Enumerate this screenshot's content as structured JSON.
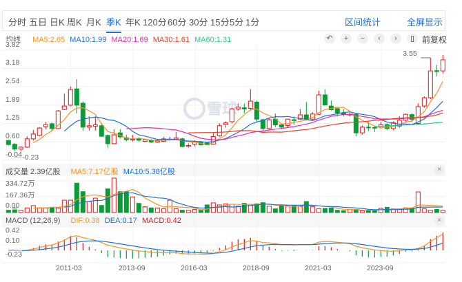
{
  "tabs": [
    "分时",
    "五日",
    "日K",
    "周K",
    "月K",
    "季K",
    "年K",
    "120分",
    "60分",
    "30分",
    "15分",
    "5分",
    "1分"
  ],
  "active_tab": "季K",
  "links": {
    "range_stats": "区间统计",
    "fullscreen": "全屏显示"
  },
  "ma_bar": {
    "label": "均线",
    "ma5": "MA5:2.65",
    "ma10": "MA10:1.99",
    "ma20": "MA20:1.69",
    "ma30": "MA30:1.61",
    "ma60": "MA60:1.31"
  },
  "tools": {
    "undo": "↶",
    "zoom_in": "+",
    "zoom_out": "−",
    "prev": "‹",
    "next": "›",
    "adjust": "前复权"
  },
  "watermark": "雪球",
  "colors": {
    "up": "#e4151b",
    "down": "#0a9b38",
    "ma5": "#f7931e",
    "ma10": "#1c6fd6",
    "ma20": "#e628b5",
    "ma30": "#f23b20",
    "ma60": "#1ccf8a"
  },
  "volume_bar": {
    "label": "成交量 2.39亿股",
    "ma5": "MA5:7.17亿股",
    "ma10": "MA10:5.38亿股",
    "close": "×"
  },
  "macd_bar": {
    "label": "MACD (12,26,9)",
    "dif": "DIF:0.38",
    "dea": "DEA:0.17",
    "macd": "MACD:0.42",
    "close": "×"
  },
  "chart_data": {
    "type": "candlestick",
    "price_ticks": [
      "3.82",
      "3.18",
      "2.54",
      "1.89",
      "1.25",
      "0.60",
      "-0.04"
    ],
    "price_range": [
      -0.04,
      3.82
    ],
    "max_label": "3.55",
    "min_label": "-0.23",
    "volume_ticks": [
      "334.72万",
      "167.36万",
      "0.00"
    ],
    "volume_max": 334.72,
    "macd_ticks": [
      "0.42",
      "0.10",
      "-0.23"
    ],
    "x_labels": [
      "2011-03",
      "2013-09",
      "2016-03",
      "2018-09",
      "2021-03",
      "2023-09"
    ],
    "candles": [
      [
        0.66,
        0.51,
        0.72,
        0.48
      ],
      [
        0.52,
        0.35,
        0.56,
        0.14
      ],
      [
        0.35,
        0.42,
        0.45,
        0.25
      ],
      [
        0.42,
        0.71,
        0.8,
        0.4
      ],
      [
        0.71,
        0.88,
        1.02,
        0.65
      ],
      [
        0.83,
        1.09,
        1.12,
        0.8
      ],
      [
        1.14,
        1.21,
        1.3,
        1.05
      ],
      [
        1.24,
        1.07,
        1.28,
        1.0
      ],
      [
        1.07,
        1.69,
        1.72,
        1.05
      ],
      [
        1.74,
        1.86,
        2.3,
        1.72
      ],
      [
        1.89,
        2.44,
        2.54,
        1.85
      ],
      [
        2.46,
        1.89,
        2.8,
        1.6
      ],
      [
        1.96,
        1.12,
        2.02,
        1.0
      ],
      [
        1.12,
        1.17,
        1.5,
        1.0
      ],
      [
        1.15,
        1.2,
        1.5,
        1.0
      ],
      [
        1.17,
        0.8,
        1.25,
        0.78
      ],
      [
        0.83,
        0.54,
        0.86,
        0.4
      ],
      [
        0.54,
        0.85,
        1.05,
        0.52
      ],
      [
        0.92,
        0.78,
        1.05,
        0.72
      ],
      [
        0.75,
        0.68,
        0.85,
        0.62
      ],
      [
        0.68,
        0.7,
        0.85,
        0.62
      ],
      [
        0.71,
        0.66,
        0.76,
        0.62
      ],
      [
        0.62,
        0.68,
        0.72,
        0.6
      ],
      [
        0.66,
        0.6,
        0.7,
        0.56
      ],
      [
        0.6,
        0.64,
        0.7,
        0.58
      ],
      [
        0.62,
        0.71,
        0.78,
        0.6
      ],
      [
        0.68,
        0.7,
        0.78,
        0.65
      ],
      [
        0.7,
        0.74,
        0.95,
        0.68
      ],
      [
        0.71,
        0.44,
        0.74,
        0.42
      ],
      [
        0.44,
        0.48,
        0.55,
        0.4
      ],
      [
        0.52,
        0.62,
        0.66,
        0.45
      ],
      [
        0.6,
        0.5,
        0.64,
        0.48
      ],
      [
        0.57,
        0.5,
        0.6,
        0.48
      ],
      [
        0.52,
        0.79,
        0.9,
        0.5
      ],
      [
        0.82,
        1.17,
        1.25,
        0.78
      ],
      [
        1.21,
        1.27,
        1.32,
        1.1
      ],
      [
        1.31,
        1.76,
        1.8,
        1.25
      ],
      [
        1.76,
        1.82,
        1.95,
        1.7
      ],
      [
        1.8,
        1.76,
        1.95,
        1.6
      ],
      [
        1.78,
        2.03,
        2.45,
        1.7
      ],
      [
        2.0,
        1.4,
        2.05,
        1.3
      ],
      [
        1.38,
        1.07,
        1.42,
        0.98
      ],
      [
        1.07,
        1.38,
        1.45,
        1.02
      ],
      [
        1.4,
        1.2,
        1.6,
        1.12
      ],
      [
        1.2,
        1.12,
        1.25,
        1.05
      ],
      [
        1.18,
        1.4,
        1.42,
        1.12
      ],
      [
        1.38,
        1.35,
        1.5,
        1.2
      ],
      [
        1.4,
        1.55,
        1.75,
        1.38
      ],
      [
        1.55,
        1.4,
        2.0,
        1.36
      ],
      [
        1.4,
        1.58,
        1.65,
        1.38
      ],
      [
        1.57,
        2.25,
        2.4,
        1.55
      ],
      [
        2.25,
        1.9,
        2.45,
        1.88
      ],
      [
        1.86,
        1.73,
        2.05,
        1.7
      ],
      [
        1.77,
        1.62,
        1.8,
        1.5
      ],
      [
        1.62,
        1.57,
        1.75,
        1.5
      ],
      [
        1.55,
        1.57,
        1.62,
        1.5
      ],
      [
        1.57,
        0.92,
        1.6,
        0.8
      ],
      [
        0.92,
        1.12,
        1.18,
        0.85
      ],
      [
        1.12,
        1.1,
        1.3,
        0.98
      ],
      [
        1.11,
        1.1,
        1.15,
        0.95
      ],
      [
        1.14,
        1.2,
        1.3,
        1.08
      ],
      [
        1.21,
        1.07,
        1.25,
        1.02
      ],
      [
        1.07,
        1.28,
        1.32,
        1.02
      ],
      [
        1.16,
        1.36,
        1.5,
        1.1
      ],
      [
        1.36,
        1.57,
        1.6,
        1.3
      ],
      [
        1.56,
        1.39,
        1.6,
        1.3
      ],
      [
        1.25,
        1.84,
        1.95,
        1.2
      ],
      [
        1.86,
        2.15,
        2.2,
        1.8
      ],
      [
        2.15,
        3.09,
        3.55,
        2.1
      ],
      [
        3.1,
        3.07,
        3.3,
        2.9
      ],
      [
        3.09,
        3.48,
        3.65,
        3.0
      ]
    ],
    "volumes": [
      22,
      51,
      22,
      45,
      67,
      45,
      45,
      51,
      45,
      120,
      120,
      286,
      203,
      107,
      140,
      69,
      230,
      335,
      203,
      203,
      152,
      89,
      56,
      45,
      45,
      36,
      120,
      36,
      22,
      22,
      29,
      22,
      74,
      94,
      74,
      85,
      80,
      62,
      89,
      80,
      85,
      96,
      62,
      36,
      74,
      62,
      67,
      58,
      107,
      58,
      36,
      40,
      45,
      22,
      18,
      29,
      29,
      18,
      22,
      18,
      40,
      51,
      36,
      36,
      45,
      45,
      201,
      36,
      22,
      30,
      22
    ]
  }
}
